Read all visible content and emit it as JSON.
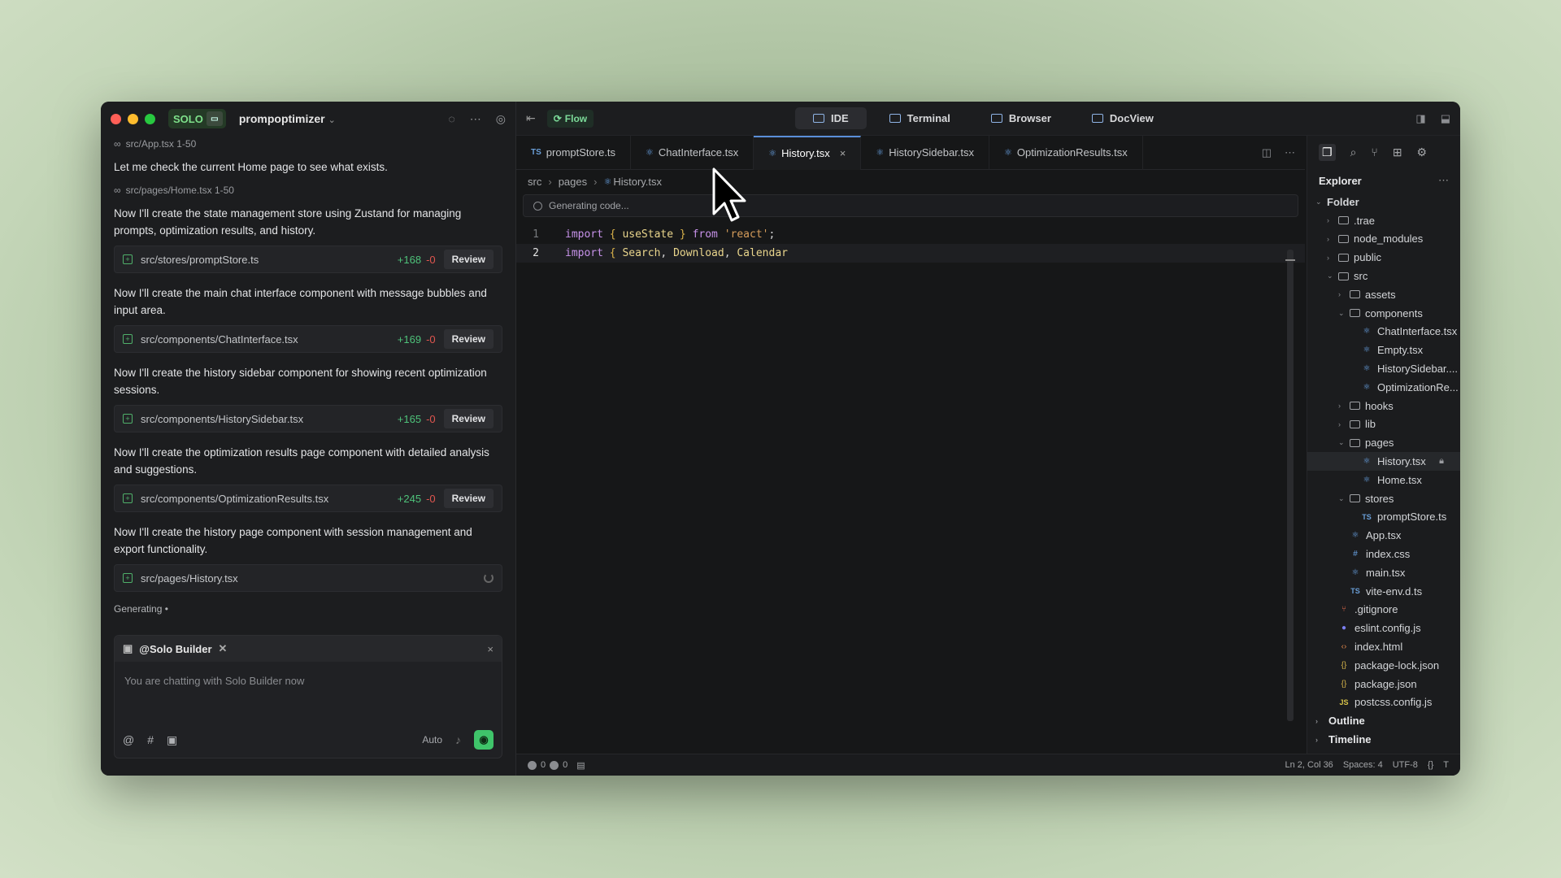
{
  "window": {
    "traffic_colors": [
      "#ff5f57",
      "#febc2e",
      "#28c840"
    ]
  },
  "left": {
    "badge": "SOLO",
    "project_name": "prompoptimizer",
    "messages": [
      {
        "type": "ref",
        "text": "src/App.tsx 1-50"
      },
      {
        "type": "msg",
        "text": "Let me check the current Home page to see what exists."
      },
      {
        "type": "ref",
        "text": "src/pages/Home.tsx 1-50"
      },
      {
        "type": "msg",
        "text": "Now I'll create the state management store using Zustand for managing prompts, optimization results, and history."
      },
      {
        "type": "card",
        "path": "src/stores/promptStore.ts",
        "added": "+168",
        "removed": "-0",
        "action": "Review"
      },
      {
        "type": "msg",
        "text": "Now I'll create the main chat interface component with message bubbles and input area."
      },
      {
        "type": "card",
        "path": "src/components/ChatInterface.tsx",
        "added": "+169",
        "removed": "-0",
        "action": "Review"
      },
      {
        "type": "msg",
        "text": "Now I'll create the history sidebar component for showing recent optimization sessions."
      },
      {
        "type": "card",
        "path": "src/components/HistorySidebar.tsx",
        "added": "+165",
        "removed": "-0",
        "action": "Review"
      },
      {
        "type": "msg",
        "text": "Now I'll create the optimization results page component with detailed analysis and suggestions."
      },
      {
        "type": "card",
        "path": "src/components/OptimizationResults.tsx",
        "added": "+245",
        "removed": "-0",
        "action": "Review"
      },
      {
        "type": "msg",
        "text": "Now I'll create the history page component with session management and export functionality."
      },
      {
        "type": "card",
        "path": "src/pages/History.tsx",
        "added": "",
        "removed": "",
        "action": "",
        "loading": true
      }
    ],
    "generating_label": "Generating •",
    "builder": {
      "title": "@Solo Builder",
      "placeholder": "You are chatting with Solo Builder now",
      "mode": "Auto"
    }
  },
  "topbar": {
    "flow_label": "Flow",
    "modes": [
      {
        "label": "IDE",
        "active": true
      },
      {
        "label": "Terminal",
        "active": false
      },
      {
        "label": "Browser",
        "active": false
      },
      {
        "label": "DocView",
        "active": false
      }
    ]
  },
  "editor": {
    "tabs": [
      {
        "label": "promptStore.ts",
        "kind": "ts",
        "active": false
      },
      {
        "label": "ChatInterface.tsx",
        "kind": "react",
        "active": false
      },
      {
        "label": "History.tsx",
        "kind": "react",
        "active": true
      },
      {
        "label": "HistorySidebar.tsx",
        "kind": "react",
        "active": false
      },
      {
        "label": "OptimizationResults.tsx",
        "kind": "react",
        "active": false
      }
    ],
    "breadcrumbs": [
      "src",
      "pages",
      "History.tsx"
    ],
    "generating_text": "Generating code...",
    "code_lines": [
      {
        "num": "1",
        "tokens": [
          [
            "kw",
            "import"
          ],
          [
            "pl",
            " "
          ],
          [
            "br",
            "{"
          ],
          [
            "pl",
            " "
          ],
          [
            "id",
            "useState"
          ],
          [
            "pl",
            " "
          ],
          [
            "br",
            "}"
          ],
          [
            "pl",
            " "
          ],
          [
            "kw",
            "from"
          ],
          [
            "pl",
            " "
          ],
          [
            "str",
            "'react'"
          ],
          [
            "pl",
            ";"
          ]
        ]
      },
      {
        "num": "2",
        "tokens": [
          [
            "kw",
            "import"
          ],
          [
            "pl",
            " "
          ],
          [
            "br",
            "{"
          ],
          [
            "pl",
            " "
          ],
          [
            "id",
            "Search"
          ],
          [
            "pl",
            ", "
          ],
          [
            "id",
            "Download"
          ],
          [
            "pl",
            ", "
          ],
          [
            "id",
            "Calendar"
          ]
        ]
      }
    ]
  },
  "explorer": {
    "title": "Explorer",
    "tree": [
      {
        "label": "Folder",
        "depth": 0,
        "kind": "root",
        "open": true
      },
      {
        "label": ".trae",
        "depth": 1,
        "kind": "folder",
        "open": false
      },
      {
        "label": "node_modules",
        "depth": 1,
        "kind": "folder",
        "open": false
      },
      {
        "label": "public",
        "depth": 1,
        "kind": "folder",
        "open": false
      },
      {
        "label": "src",
        "depth": 1,
        "kind": "folder",
        "open": true
      },
      {
        "label": "assets",
        "depth": 2,
        "kind": "folder",
        "open": false
      },
      {
        "label": "components",
        "depth": 2,
        "kind": "folder",
        "open": true
      },
      {
        "label": "ChatInterface.tsx",
        "depth": 3,
        "kind": "react"
      },
      {
        "label": "Empty.tsx",
        "depth": 3,
        "kind": "react"
      },
      {
        "label": "HistorySidebar....",
        "depth": 3,
        "kind": "react"
      },
      {
        "label": "OptimizationRe...",
        "depth": 3,
        "kind": "react"
      },
      {
        "label": "hooks",
        "depth": 2,
        "kind": "folder",
        "open": false
      },
      {
        "label": "lib",
        "depth": 2,
        "kind": "folder",
        "open": false
      },
      {
        "label": "pages",
        "depth": 2,
        "kind": "folder",
        "open": true
      },
      {
        "label": "History.tsx",
        "depth": 3,
        "kind": "react",
        "selected": true,
        "locked": true
      },
      {
        "label": "Home.tsx",
        "depth": 3,
        "kind": "react"
      },
      {
        "label": "stores",
        "depth": 2,
        "kind": "folder",
        "open": true
      },
      {
        "label": "promptStore.ts",
        "depth": 3,
        "kind": "ts"
      },
      {
        "label": "App.tsx",
        "depth": 2,
        "kind": "react"
      },
      {
        "label": "index.css",
        "depth": 2,
        "kind": "css"
      },
      {
        "label": "main.tsx",
        "depth": 2,
        "kind": "react"
      },
      {
        "label": "vite-env.d.ts",
        "depth": 2,
        "kind": "ts"
      },
      {
        "label": ".gitignore",
        "depth": 1,
        "kind": "git"
      },
      {
        "label": "eslint.config.js",
        "depth": 1,
        "kind": "eslint"
      },
      {
        "label": "index.html",
        "depth": 1,
        "kind": "html"
      },
      {
        "label": "package-lock.json",
        "depth": 1,
        "kind": "json"
      },
      {
        "label": "package.json",
        "depth": 1,
        "kind": "json"
      },
      {
        "label": "postcss.config.js",
        "depth": 1,
        "kind": "js"
      }
    ],
    "sections": [
      "Outline",
      "Timeline"
    ]
  },
  "status": {
    "errors": "0",
    "warnings": "0",
    "position": "Ln 2, Col 36",
    "spaces": "Spaces: 4",
    "encoding": "UTF-8",
    "lang_icon": "{}",
    "extra": "T"
  }
}
